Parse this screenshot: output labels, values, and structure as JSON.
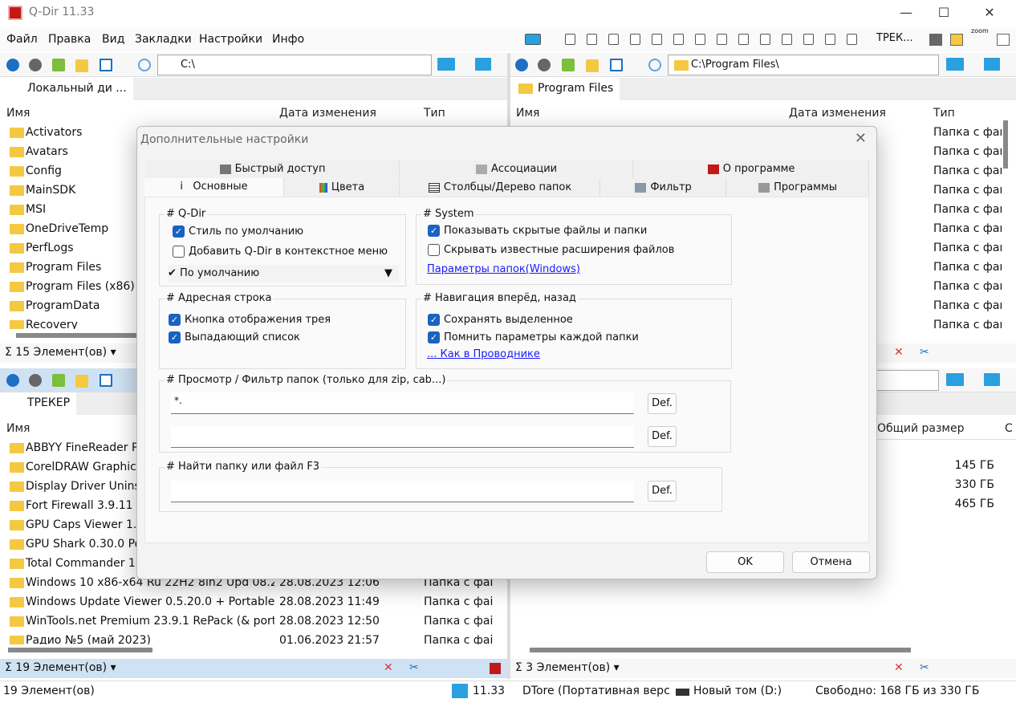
{
  "window": {
    "title": "Q-Dir 11.33",
    "minimize": "—",
    "maximize": "☐",
    "close": "✕"
  },
  "menu": [
    "Файл",
    "Правка",
    "Вид",
    "Закладки",
    "Настройки",
    "Инфо"
  ],
  "toolbar_right": {
    "bookmark_label": "ТРЕК...",
    "zoom_label": "zoom"
  },
  "panes": {
    "top_left": {
      "address": "C:\\",
      "tab": "Локальный ди ...",
      "columns": [
        "Имя",
        "Дата изменения",
        "Тип"
      ],
      "rows": [
        "Activators",
        "Avatars",
        "Config",
        "MainSDK",
        "MSI",
        "OneDriveTemp",
        "PerfLogs",
        "Program Files",
        "Program Files (x86)",
        "ProgramData",
        "Recovery"
      ],
      "status": "15 Элемент(ов)"
    },
    "top_right": {
      "address": "C:\\Program Files\\",
      "tab": "Program Files",
      "columns": [
        "Имя",
        "Дата изменения",
        "Тип"
      ],
      "type_value": "Папка с фай",
      "row_count": 11
    },
    "bottom_left": {
      "tab": "ТРЕКЕР",
      "columns": [
        "Имя"
      ],
      "rows": [
        {
          "name": "ABBYY FineReader PD",
          "date": "",
          "type": ""
        },
        {
          "name": "CorelDRAW Graphics",
          "date": "",
          "type": ""
        },
        {
          "name": "Display Driver Uninst",
          "date": "",
          "type": ""
        },
        {
          "name": "Fort Firewall 3.9.11 +",
          "date": "",
          "type": ""
        },
        {
          "name": "GPU Caps Viewer 1.6",
          "date": "",
          "type": ""
        },
        {
          "name": "GPU Shark 0.30.0 Port",
          "date": "",
          "type": ""
        },
        {
          "name": "Total Commander 11",
          "date": "",
          "type": ""
        },
        {
          "name": "Windows 10 x86-x64 Ru 22H2 8in2 Upd 08.2...",
          "date": "28.08.2023 12:06",
          "type": "Папка с фаі"
        },
        {
          "name": "Windows Update Viewer 0.5.20.0 + Portable",
          "date": "28.08.2023 11:49",
          "type": "Папка с фаі"
        },
        {
          "name": "WinTools.net Premium 23.9.1 RePack (& port...",
          "date": "28.08.2023 12:50",
          "type": "Папка с фаі"
        },
        {
          "name": "Радио №5 (май 2023)",
          "date": "01.06.2023 21:57",
          "type": "Папка с фаі"
        }
      ],
      "status": "19 Элемент(ов)"
    },
    "bottom_right": {
      "columns": [
        "Общий размер",
        "С"
      ],
      "sizes": [
        "145 ГБ",
        "330 ГБ",
        "465 ГБ"
      ],
      "status": "3 Элемент(ов)"
    }
  },
  "dialog": {
    "title": "Дополнительные настройки",
    "tabs_row1": [
      "Быстрый доступ",
      "Ассоциации",
      "О программе"
    ],
    "tabs_row2": [
      "Основные",
      "Цвета",
      "Столбцы/Дерево папок",
      "Фильтр",
      "Программы"
    ],
    "active_tab": "Основные",
    "qdir": {
      "label": "# Q-Dir",
      "options": [
        {
          "label": "Стиль по умолчанию",
          "checked": true
        },
        {
          "label": "Добавить Q-Dir в контекстное меню",
          "checked": false
        }
      ],
      "dropdown": "По умолчанию"
    },
    "system": {
      "label": "# System",
      "options": [
        {
          "label": "Показывать скрытые файлы и папки",
          "checked": true
        },
        {
          "label": "Скрывать известные расширения файлов",
          "checked": false
        }
      ],
      "link": "Параметры папок(Windows)"
    },
    "address": {
      "label": "# Адресная строка",
      "options": [
        {
          "label": "Кнопка отображения трея",
          "checked": true
        },
        {
          "label": "Выпадающий список",
          "checked": true
        }
      ]
    },
    "nav": {
      "label": "# Навигация вперёд, назад",
      "options": [
        {
          "label": "Сохранять выделенное",
          "checked": true
        },
        {
          "label": "Помнить параметры каждой папки",
          "checked": true
        }
      ],
      "link": "... Как в Проводнике"
    },
    "filter": {
      "label": "# Просмотр / Фильтр папок (только для zip, cab...)",
      "value1": "*.",
      "value2": "",
      "def": "Def."
    },
    "find": {
      "label": "# Найти папку или файл   F3",
      "value": "",
      "def": "Def."
    },
    "ok": "OK",
    "cancel": "Отмена"
  },
  "statusbar": {
    "items": "19 Элемент(ов)",
    "version": "11.33",
    "app": "DTore (Портативная верси",
    "drive": "Новый том (D:)",
    "free": "Свободно: 168 ГБ из 330 ГБ"
  },
  "colors": {
    "accent": "#1a62c0",
    "active_pane": "#cfe2f3",
    "folder": "#f5c842",
    "link": "#1a1aff"
  }
}
